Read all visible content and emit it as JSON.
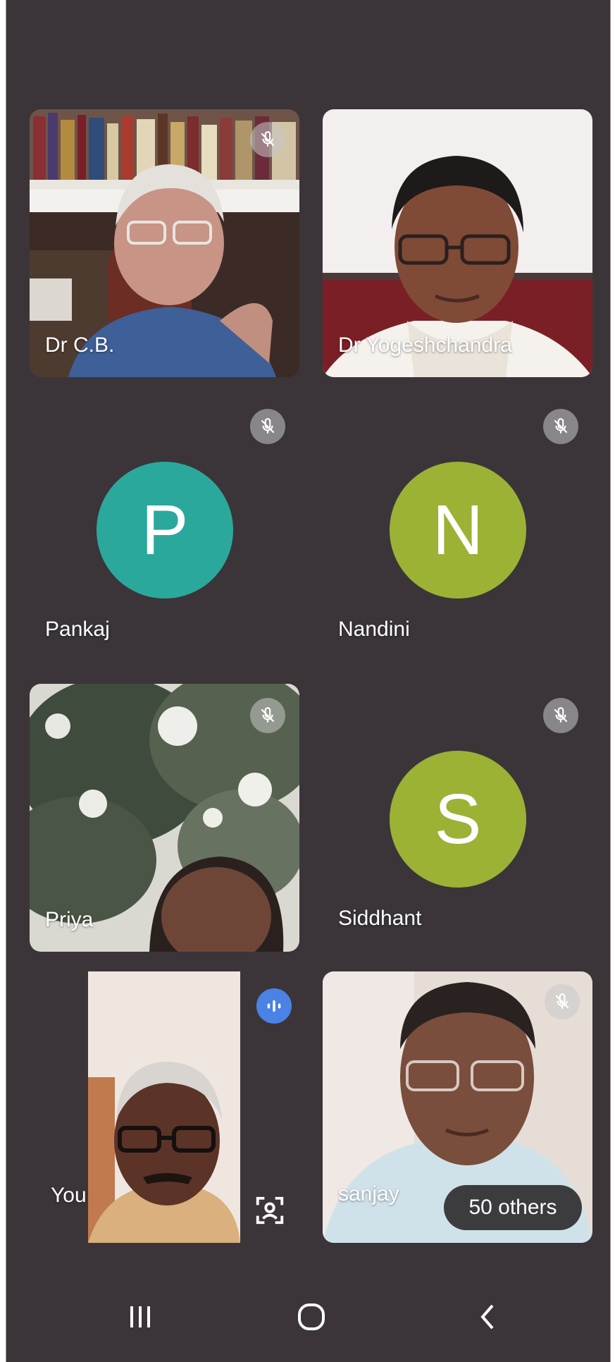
{
  "participants": [
    {
      "name": "Dr C.B.",
      "muted": true,
      "video": true
    },
    {
      "name": "Dr Yogeshchandra",
      "muted": false,
      "video": true
    },
    {
      "name": "Pankaj",
      "muted": true,
      "video": false,
      "initial": "P",
      "avatar_color": "#2ba89c"
    },
    {
      "name": "Nandini",
      "muted": true,
      "video": false,
      "initial": "N",
      "avatar_color": "#9bb235"
    },
    {
      "name": "Priya",
      "muted": true,
      "video": true
    },
    {
      "name": "Siddhant",
      "muted": true,
      "video": false,
      "initial": "S",
      "avatar_color": "#9bb235"
    },
    {
      "name": "You",
      "speaking": true,
      "video": true
    },
    {
      "name": "sanjay",
      "muted": true,
      "video": true
    }
  ],
  "others_chip": "50 others",
  "icons": {
    "mute": "mic-off-icon",
    "speaking": "audio-level-icon",
    "self_view": "face-frame-icon",
    "nav_recents": "recents-icon",
    "nav_home": "home-icon",
    "nav_back": "back-icon"
  },
  "colors": {
    "background": "#3b353a",
    "speaking_badge": "#4a82e6"
  }
}
